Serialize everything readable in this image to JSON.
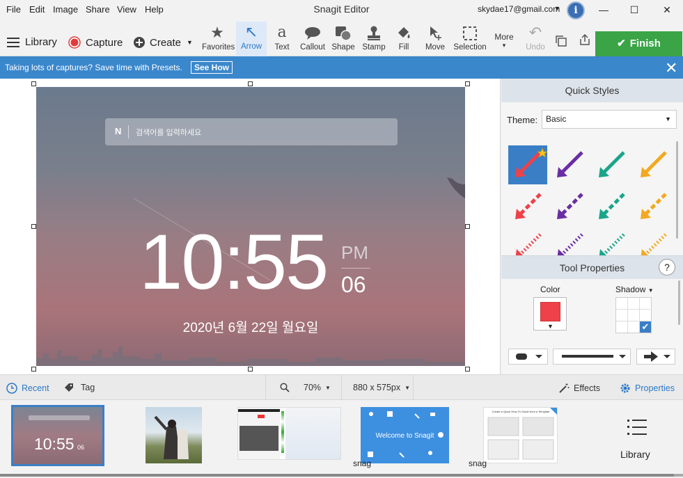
{
  "menu": [
    "File",
    "Edit",
    "Image",
    "Share",
    "View",
    "Help"
  ],
  "app_title": "Snagit Editor",
  "account": {
    "email": "skydae17@gmail.com",
    "info": "i"
  },
  "window": {
    "minimize": "—",
    "maximize": "☐",
    "close": "✕"
  },
  "toolbar": {
    "library": "Library",
    "capture": "Capture",
    "create": "Create",
    "tools": [
      {
        "label": "Favorites",
        "icon": "★"
      },
      {
        "label": "Arrow",
        "icon": "↖"
      },
      {
        "label": "Text",
        "icon": "a"
      },
      {
        "label": "Callout",
        "icon": "💬"
      },
      {
        "label": "Shape",
        "icon": "◼"
      },
      {
        "label": "Stamp",
        "icon": "⬣"
      },
      {
        "label": "Fill",
        "icon": "⛽"
      },
      {
        "label": "Move",
        "icon": "➤"
      },
      {
        "label": "Selection",
        "icon": "⬚"
      },
      {
        "label": "More",
        "icon": "▾"
      },
      {
        "label": "Undo",
        "icon": "↶"
      }
    ],
    "finish": "Finish"
  },
  "banner": {
    "text": "Taking lots of captures? Save time with Presets.",
    "link": "See How"
  },
  "capture_image": {
    "search_placeholder": "검색어를 입력하세요",
    "search_logo": "N",
    "time": "10:55",
    "ampm": "PM",
    "seconds": "06",
    "date": "2020년 6월 22일 월요일"
  },
  "panel": {
    "quick_styles": "Quick Styles",
    "theme_label": "Theme:",
    "theme_value": "Basic",
    "tool_properties": "Tool Properties",
    "help": "?",
    "color_label": "Color",
    "shadow_label": "Shadow",
    "accent": "#ef4149",
    "arrow_colors": [
      "#ef4149",
      "#6a2ea3",
      "#1aa58a",
      "#f2a921"
    ]
  },
  "statusbar": {
    "recent": "Recent",
    "tag": "Tag",
    "zoom": "70%",
    "dimensions": "880 x 575px",
    "effects": "Effects",
    "properties": "Properties"
  },
  "tray": {
    "items": [
      {
        "name": "",
        "thumb_time": "10:55",
        "thumb_sec": "06"
      },
      {
        "name": ""
      },
      {
        "name": ""
      },
      {
        "name": "snag",
        "caption": "Welcome to Snagit"
      },
      {
        "name": "snag",
        "caption": "Create a Quick How-To Guide from a Template"
      }
    ],
    "library": "Library"
  }
}
